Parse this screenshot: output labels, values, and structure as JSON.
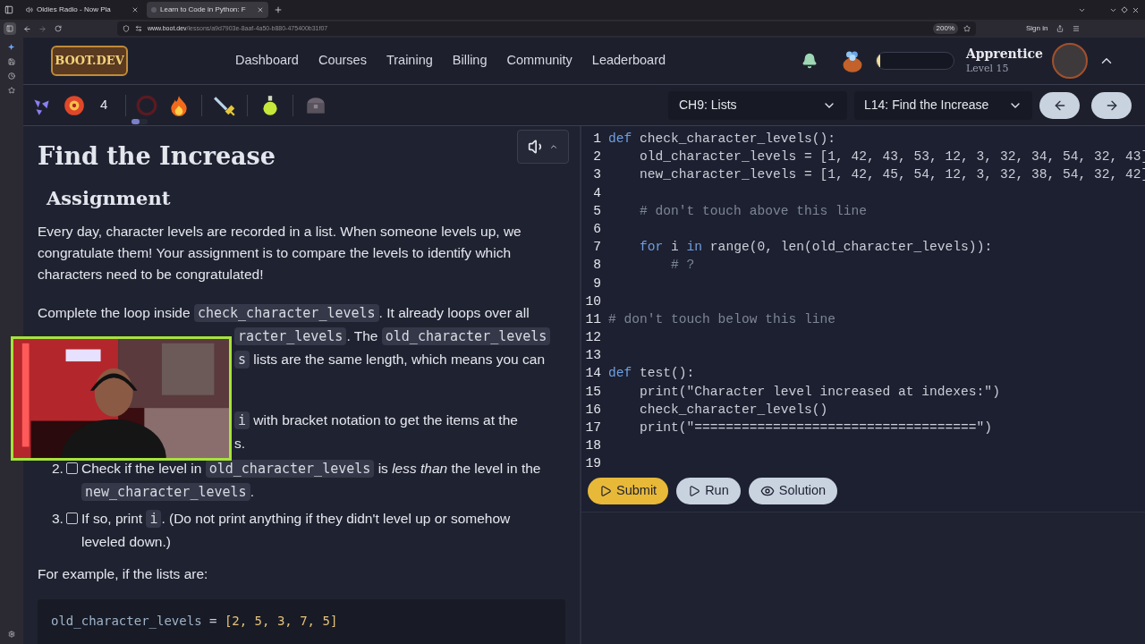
{
  "browser": {
    "tabs": [
      {
        "title": "Oldies Radio - Now Pla",
        "selected": false,
        "audio": true
      },
      {
        "title": "Learn to Code in Python: F",
        "selected": true,
        "audio": false
      }
    ],
    "url_host": "www.boot.dev",
    "url_path": "/lessons/a9d7903e-8aaf-4a50-b880-475400b31f07",
    "zoom": "200%",
    "sign_in": "Sign in"
  },
  "site": {
    "logo": "BOOT.DEV",
    "nav": [
      "Dashboard",
      "Courses",
      "Training",
      "Billing",
      "Community",
      "Leaderboard"
    ],
    "xp": {
      "level": 0.05
    },
    "rank": "Apprentice",
    "level_text": "Level 15"
  },
  "toolbar": {
    "count": "4",
    "toggle": {
      "on": false
    },
    "chapter": "CH9: Lists",
    "lesson": "L14: Find the Increase"
  },
  "lesson": {
    "title": "Find the Increase",
    "heading": "Assignment",
    "intro": "Every day, character levels are recorded in a list. When someone levels up, we congratulate them! Your assignment is to compare the levels to identify which characters need to be congratulated!",
    "loop_line": [
      {
        "text": "Complete the loop inside "
      },
      {
        "code": "check_character_levels"
      },
      {
        "text": ". It already loops over all"
      }
    ],
    "covered_lines": [
      {
        "parts": [
          {
            "code": "racter_levels"
          },
          {
            "text": ". The "
          },
          {
            "code": "old_character_levels"
          }
        ]
      },
      {
        "parts": [
          {
            "code": "s"
          },
          {
            "text": " lists are the same length, which means you can"
          }
        ]
      },
      {
        "parts": [
          {
            "code": "i"
          },
          {
            "text": " with bracket notation to get the items at the"
          }
        ]
      },
      {
        "parts": [
          {
            "text": "s."
          }
        ]
      }
    ],
    "steps": [
      {
        "number": "2.",
        "checked": false,
        "parts": [
          {
            "text": "Check if the level in "
          },
          {
            "code": "old_character_levels"
          },
          {
            "text": " is *less than* the level in the "
          },
          {
            "code": "new_character_levels"
          },
          {
            "text": "."
          }
        ]
      },
      {
        "number": "3.",
        "checked": false,
        "parts": [
          {
            "text": "If so, print "
          },
          {
            "code": "i"
          },
          {
            "text": ". (Do not print anything if they didn't level up or somehow leveled down.)"
          }
        ]
      }
    ],
    "example_intro": "For example, if the lists are:",
    "example_code": [
      [
        {
          "kind": "name",
          "text": "old_character_levels"
        },
        {
          "kind": "op",
          "text": " = "
        },
        {
          "kind": "value",
          "text": "[2, 5, 3, 7, 5]"
        }
      ]
    ],
    "webcam": {
      "kind": "picture"
    }
  },
  "editor": {
    "lines": [
      {
        "n": "1",
        "tokens": [
          {
            "kind": "kw",
            "text": "def"
          },
          {
            "kind": "plain",
            "text": " check_character_levels():"
          }
        ]
      },
      {
        "n": "2",
        "tokens": [
          {
            "kind": "plain",
            "text": "    old_character_levels = [1, 42, 43, 53, 12, 3, 32, 34, 54, 32, 43]"
          }
        ]
      },
      {
        "n": "3",
        "tokens": [
          {
            "kind": "plain",
            "text": "    new_character_levels = [1, 42, 45, 54, 12, 3, 32, 38, 54, 32, 42]"
          }
        ]
      },
      {
        "n": "4"
      },
      {
        "n": "5",
        "tokens": [
          {
            "kind": "comment",
            "text": "    # don't touch above this line"
          }
        ]
      },
      {
        "n": "6"
      },
      {
        "n": "7",
        "tokens": [
          {
            "kind": "kw",
            "text": "    for"
          },
          {
            "kind": "plain",
            "text": " i "
          },
          {
            "kind": "kw",
            "text": "in"
          },
          {
            "kind": "plain",
            "text": " range(0, len(old_character_levels)):"
          }
        ]
      },
      {
        "n": "8",
        "tokens": [
          {
            "kind": "comment",
            "text": "        # ?"
          }
        ]
      },
      {
        "n": "9"
      },
      {
        "n": "10"
      },
      {
        "n": "11",
        "tokens": [
          {
            "kind": "comment",
            "text": "# don't touch below this line"
          }
        ]
      },
      {
        "n": "12"
      },
      {
        "n": "13"
      },
      {
        "n": "14",
        "tokens": [
          {
            "kind": "kw",
            "text": "def"
          },
          {
            "kind": "plain",
            "text": " test():"
          }
        ]
      },
      {
        "n": "15",
        "tokens": [
          {
            "kind": "plain",
            "text": "    print(\"Character level increased at indexes:\")"
          }
        ]
      },
      {
        "n": "16",
        "tokens": [
          {
            "kind": "plain",
            "text": "    check_character_levels()"
          }
        ]
      },
      {
        "n": "17",
        "tokens": [
          {
            "kind": "plain",
            "text": "    print(\"====================================\")"
          }
        ]
      },
      {
        "n": "18"
      },
      {
        "n": "19"
      }
    ]
  },
  "buttons": [
    {
      "kind": "submit",
      "label": "Submit"
    },
    {
      "kind": "run",
      "label": "Run"
    },
    {
      "kind": "solution",
      "label": "Solution"
    }
  ]
}
